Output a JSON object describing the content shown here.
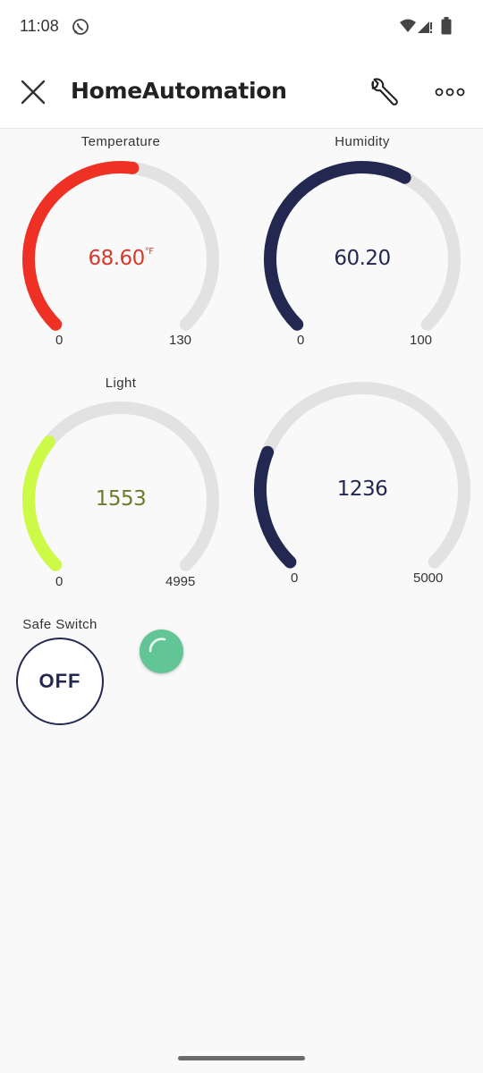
{
  "status_bar": {
    "time": "11:08",
    "icons": [
      "whatsapp-icon",
      "wifi-icon",
      "signal-icon",
      "battery-icon"
    ]
  },
  "app_bar": {
    "title": "HomeAutomation",
    "icons": [
      "close-icon",
      "wrench-icon",
      "more-icon"
    ]
  },
  "gauges": [
    {
      "id": "temperature",
      "label": "Temperature",
      "value": "68.60",
      "unit": "°F",
      "value_num": 68.6,
      "min": "0",
      "max": "130",
      "min_num": 0,
      "max_num": 130,
      "color": "#ee3124",
      "value_color": "#d63a2e"
    },
    {
      "id": "humidity",
      "label": "Humidity",
      "value": "60.20",
      "unit": "",
      "value_num": 60.2,
      "min": "0",
      "max": "100",
      "min_num": 0,
      "max_num": 100,
      "color": "#232850",
      "value_color": "#232850"
    },
    {
      "id": "light",
      "label": "Light",
      "value": "1553",
      "unit": "",
      "value_num": 1553,
      "min": "0",
      "max": "4995",
      "min_num": 0,
      "max_num": 4995,
      "color": "#cdfa46",
      "value_color": "#6e7a2a"
    },
    {
      "id": "gauge4",
      "label": "",
      "value": "1236",
      "unit": "",
      "value_num": 1236,
      "min": "0",
      "max": "5000",
      "min_num": 0,
      "max_num": 5000,
      "color": "#232850",
      "value_color": "#232850"
    }
  ],
  "switch": {
    "label": "Safe Switch",
    "state": "OFF",
    "color": "#232850"
  },
  "led": {
    "color": "#62c596"
  },
  "colors": {
    "track": "#e2e2e2",
    "background": "#f9f9f9"
  }
}
